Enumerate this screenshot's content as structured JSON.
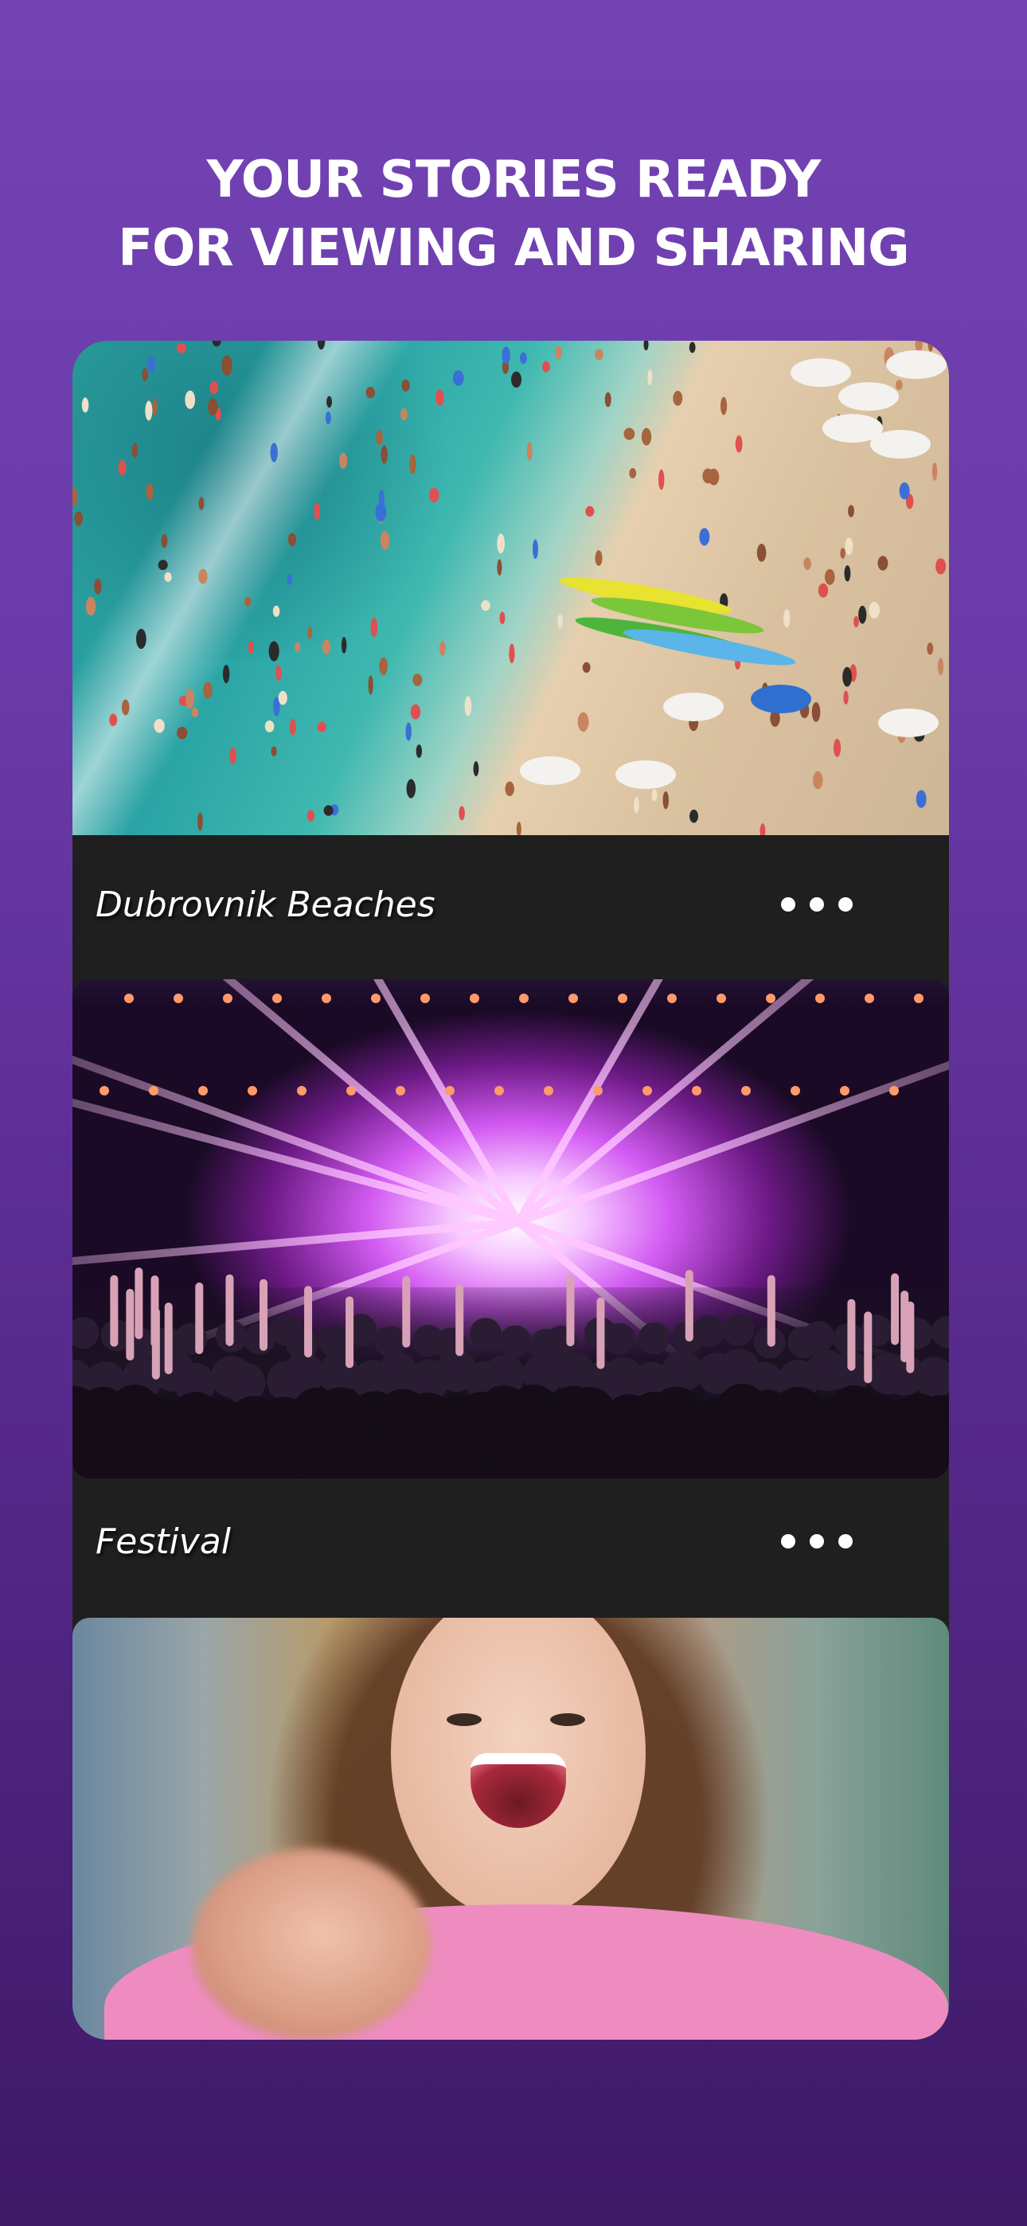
{
  "headline": {
    "line1": "YOUR STORIES READY",
    "line2": "FOR VIEWING AND SHARING"
  },
  "stories": [
    {
      "title": "Dubrovnik Beaches",
      "image": "beach-crowd-photo",
      "more_icon": "more-horizontal-icon"
    },
    {
      "title": "Festival",
      "image": "concert-stage-photo",
      "more_icon": "more-horizontal-icon"
    },
    {
      "title": "",
      "image": "woman-pointing-photo"
    }
  ],
  "colors": {
    "background_top": "#7443b4",
    "background_bottom": "#3e1966",
    "card_bar": "#1f1f1f",
    "text": "#ffffff"
  }
}
